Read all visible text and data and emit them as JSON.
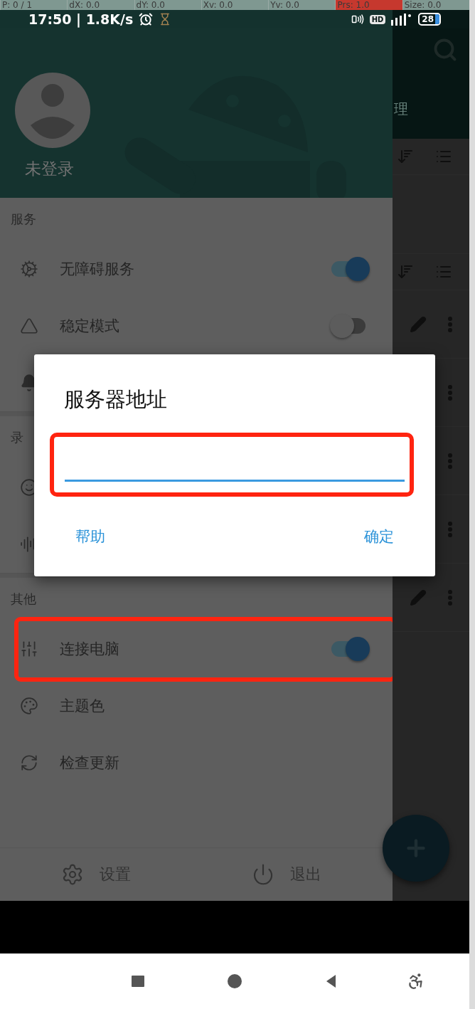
{
  "debug_bar": [
    {
      "text": "P: 0 / 1",
      "highlighted": false
    },
    {
      "text": "dX: 0.0",
      "highlighted": false
    },
    {
      "text": "dY: 0.0",
      "highlighted": false
    },
    {
      "text": "Xv: 0.0",
      "highlighted": false
    },
    {
      "text": "Yv: 0.0",
      "highlighted": false
    },
    {
      "text": "Prs: 1.0",
      "highlighted": true
    },
    {
      "text": "Size: 0.0",
      "highlighted": false
    }
  ],
  "status_bar": {
    "time": "17:50 | 1.8K/s",
    "hd_badge": "HD",
    "battery": "28"
  },
  "background_app": {
    "title_fragment": "理"
  },
  "drawer": {
    "user": "未登录",
    "sections": [
      {
        "title": "服务",
        "items": [
          {
            "kind": "switch",
            "label": "无障碍服务",
            "on": true,
            "marked": false
          },
          {
            "kind": "switch",
            "label": "稳定模式",
            "on": false,
            "marked": false
          },
          {
            "kind": "plain",
            "marked": false
          }
        ]
      },
      {
        "title": "录",
        "items": [
          {
            "kind": "plain",
            "marked": false
          },
          {
            "kind": "plain",
            "marked": false
          }
        ]
      },
      {
        "title": "其他",
        "items": [
          {
            "kind": "switch",
            "label": "连接电脑",
            "on": true,
            "marked": true
          },
          {
            "kind": "plain",
            "label": "主题色",
            "marked": false
          },
          {
            "kind": "plain",
            "label": "检查更新",
            "marked": false
          }
        ]
      }
    ],
    "footer": [
      {
        "label": "设置"
      },
      {
        "label": "退出"
      }
    ]
  },
  "dialog": {
    "title": "服务器地址",
    "input": {
      "focused": true,
      "marked": true
    },
    "buttons": [
      "帮助",
      "确定"
    ]
  }
}
